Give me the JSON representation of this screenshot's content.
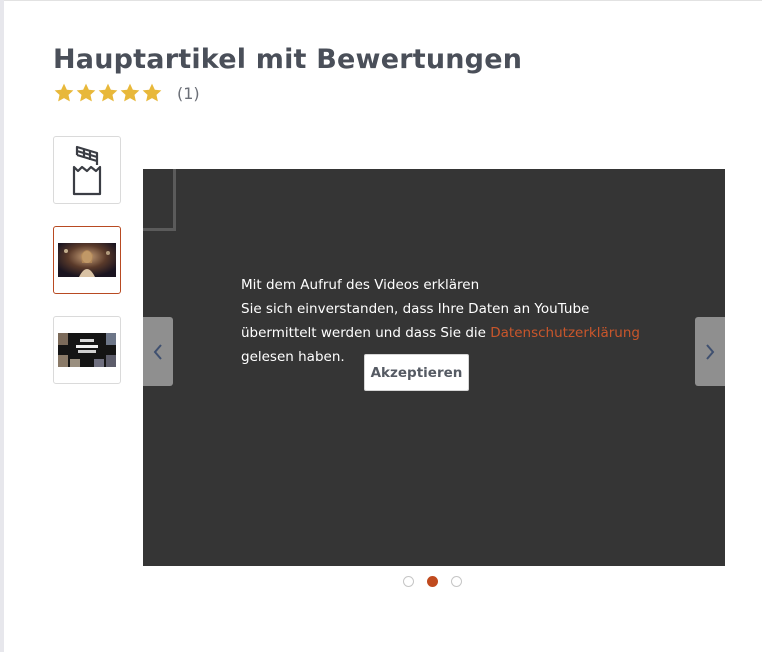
{
  "product": {
    "title": "Hauptartikel mit Bewertungen",
    "rating": {
      "stars": 5,
      "count_label": "(1)"
    }
  },
  "thumbnails": [
    {
      "name": "chocolate-bar-icon",
      "active": false
    },
    {
      "name": "video-thumbnail-1",
      "active": true
    },
    {
      "name": "video-thumbnail-2",
      "active": false
    }
  ],
  "player": {
    "consent": {
      "line1": "Mit dem Aufruf des Videos erklären",
      "line2": "Sie sich einverstanden, dass Ihre Daten an YouTube",
      "line3_prefix": "übermittelt werden und dass Sie die ",
      "privacy_link": "Datenschutzerklärung",
      "line4": "gelesen haben."
    },
    "accept_label": "Akzeptieren",
    "prev_icon": "chevron-left-icon",
    "next_icon": "chevron-right-icon"
  },
  "pagination": {
    "count": 3,
    "active_index": 1
  },
  "colors": {
    "accent": "#c04a1e",
    "title": "#4a4f59",
    "star": "#e8b83a",
    "player_bg": "#353535"
  }
}
